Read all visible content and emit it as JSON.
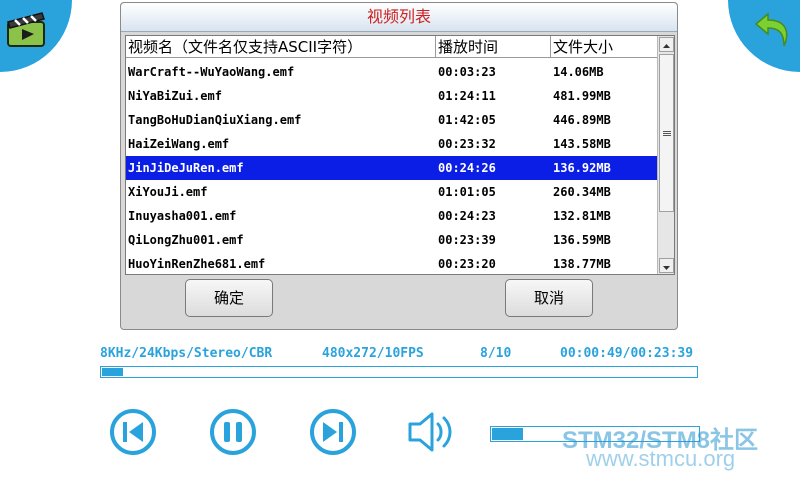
{
  "dialog": {
    "title": "视频列表",
    "columns": [
      "视频名（文件名仅支持ASCII字符）",
      "播放时间",
      "文件大小"
    ],
    "rows": [
      {
        "name": "WarCraft--WuYaoWang.emf",
        "time": "00:03:23",
        "size": "14.06MB"
      },
      {
        "name": "NiYaBiZui.emf",
        "time": "01:24:11",
        "size": "481.99MB"
      },
      {
        "name": "TangBoHuDianQiuXiang.emf",
        "time": "01:42:05",
        "size": "446.89MB"
      },
      {
        "name": "HaiZeiWang.emf",
        "time": "00:23:32",
        "size": "143.58MB"
      },
      {
        "name": "JinJiDeJuRen.emf",
        "time": "00:24:26",
        "size": "136.92MB",
        "selected": true
      },
      {
        "name": "XiYouJi.emf",
        "time": "01:01:05",
        "size": "260.34MB"
      },
      {
        "name": "Inuyasha001.emf",
        "time": "00:24:23",
        "size": "132.81MB"
      },
      {
        "name": "QiLongZhu001.emf",
        "time": "00:23:39",
        "size": "136.59MB"
      },
      {
        "name": "HuoYinRenZhe681.emf",
        "time": "00:23:20",
        "size": "138.77MB"
      }
    ],
    "ok_label": "确定",
    "cancel_label": "取消"
  },
  "status": {
    "audio": "8KHz/24Kbps/Stereo/CBR",
    "video": "480x272/10FPS",
    "index": "8/10",
    "time": "00:00:49/00:23:39",
    "progress_fraction": 0.035
  },
  "controls": {
    "icons": [
      "previous-icon",
      "pause-icon",
      "next-icon",
      "speaker-icon"
    ],
    "volume_fraction": 0.15
  },
  "watermark": {
    "line1": "STM32/STM8社区",
    "line2": "www.stmcu.org"
  },
  "colors": {
    "accent": "#2aa3dc",
    "selection": "#0a1ee6",
    "title_text": "#cc2222"
  }
}
